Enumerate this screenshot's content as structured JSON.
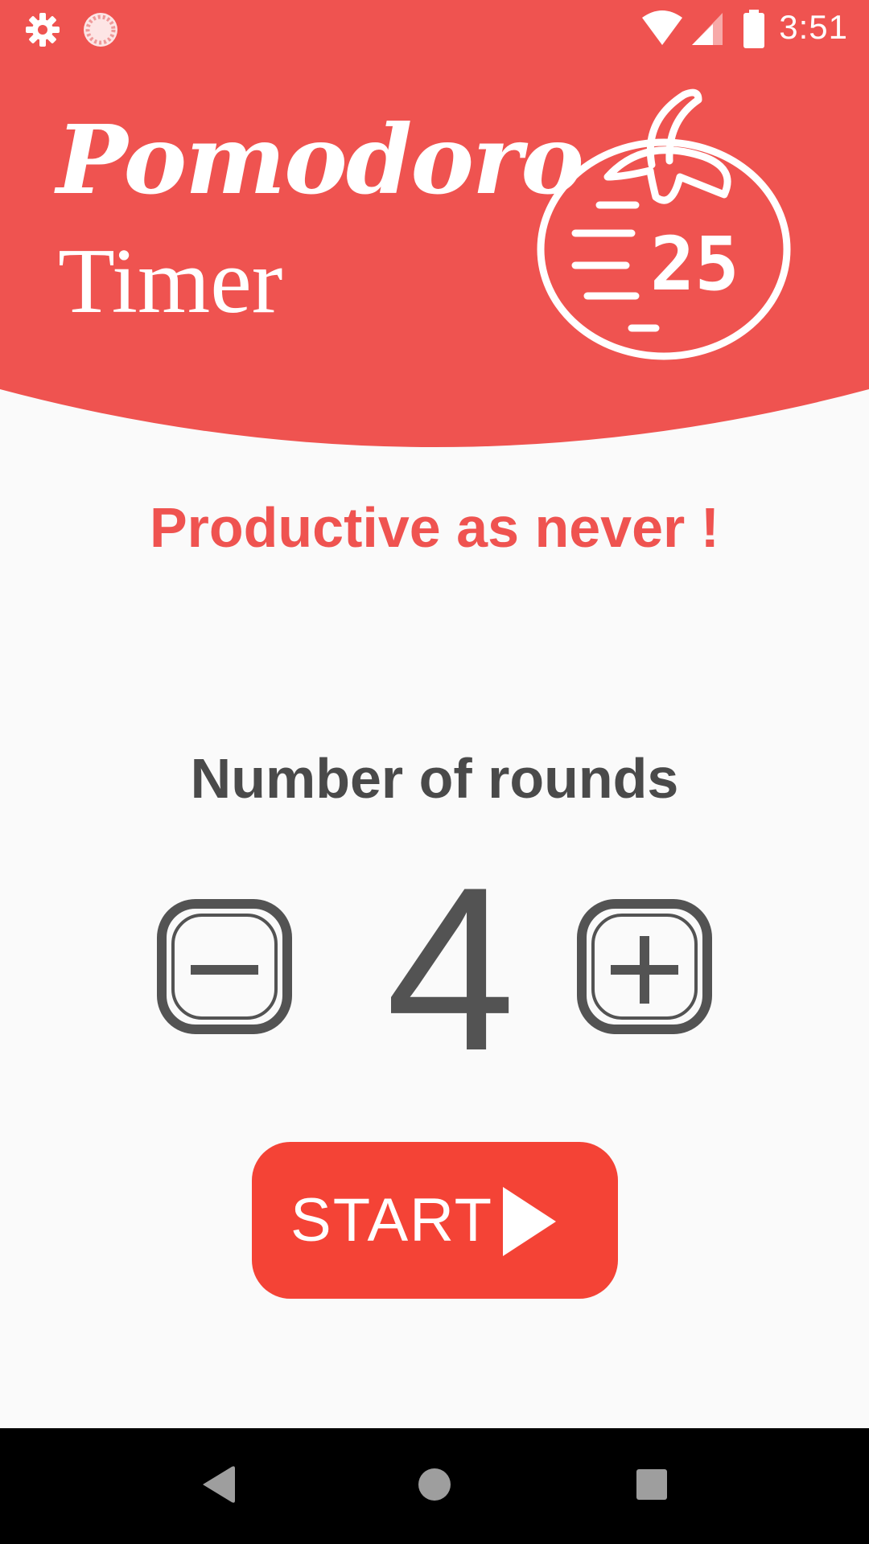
{
  "status_bar": {
    "time": "3:51",
    "icons": [
      "settings-gear-icon",
      "pomodoro-notification-icon",
      "wifi-icon",
      "cell-signal-icon",
      "battery-icon"
    ]
  },
  "header": {
    "title_line1": "Pomodoro",
    "title_line2": "Timer",
    "logo_number": "25",
    "background_color": "#ef5350"
  },
  "main": {
    "tagline": "Productive as never !",
    "rounds_label": "Number of rounds",
    "rounds_value": "4",
    "decrement_icon": "minus-icon",
    "increment_icon": "plus-icon",
    "start_label": "START",
    "start_color": "#f44336",
    "text_color": "#535353"
  },
  "nav_bar": {
    "buttons": [
      "back-icon",
      "home-icon",
      "recents-icon"
    ]
  }
}
